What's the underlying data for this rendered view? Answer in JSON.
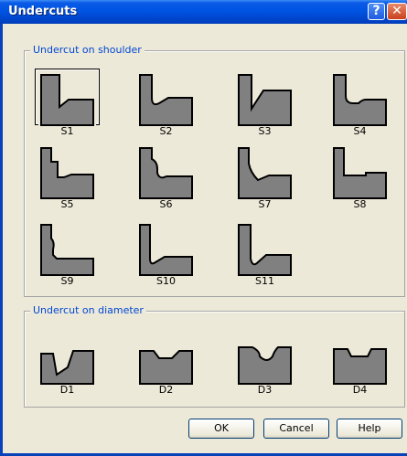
{
  "window": {
    "title": "Undercuts",
    "help_button": "?",
    "close_button": "✕"
  },
  "shoulder": {
    "title": "Undercut on shoulder",
    "items": [
      {
        "label": "S1",
        "selected": true
      },
      {
        "label": "S2"
      },
      {
        "label": "S3"
      },
      {
        "label": "S4"
      },
      {
        "label": "S5"
      },
      {
        "label": "S6"
      },
      {
        "label": "S7"
      },
      {
        "label": "S8"
      },
      {
        "label": "S9"
      },
      {
        "label": "S10"
      },
      {
        "label": "S11"
      }
    ]
  },
  "diameter": {
    "title": "Undercut on diameter",
    "items": [
      {
        "label": "D1"
      },
      {
        "label": "D2"
      },
      {
        "label": "D3"
      },
      {
        "label": "D4"
      }
    ]
  },
  "buttons": {
    "ok": "OK",
    "cancel": "Cancel",
    "help": "Help"
  },
  "colors": {
    "title_bar": "#0054e3",
    "dialog_bg": "#ece9d8",
    "part_fill": "#808080",
    "group_title": "#0046d5"
  }
}
